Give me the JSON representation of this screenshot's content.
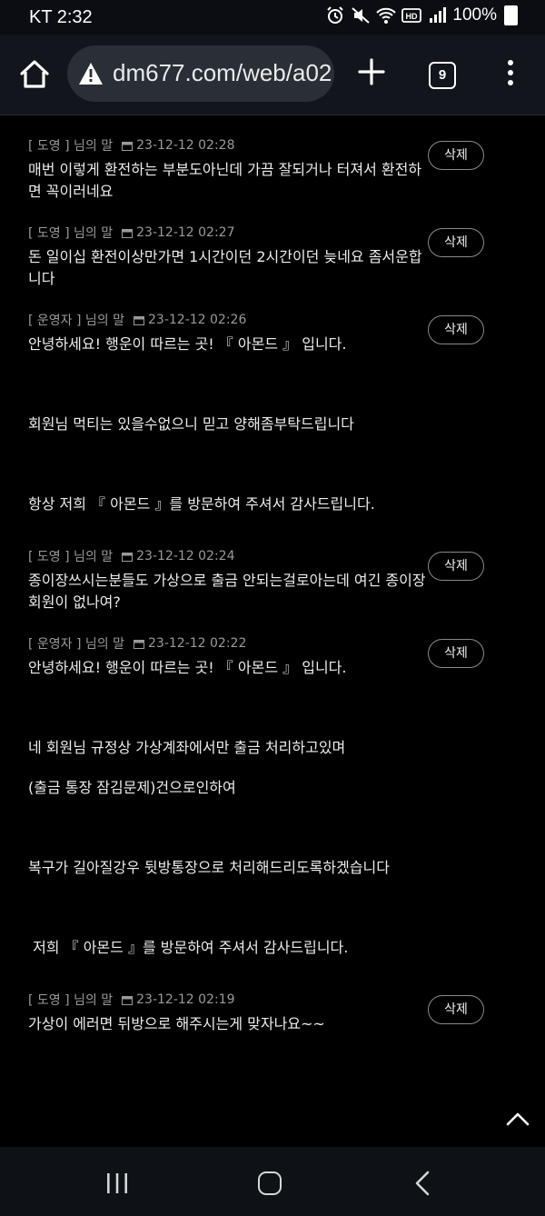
{
  "status_bar": {
    "carrier_time": "KT 2:32",
    "battery": "100%"
  },
  "browser": {
    "url": "dm677.com/web/a02",
    "tab_count": "9"
  },
  "comments": [
    {
      "role": "[ 도영 ]",
      "suffix": "님의 말",
      "date": "23-12-12 02:28",
      "lines": [
        "매번 이렇게 환전하는 부분도아닌데 가끔 잘되거나 터져서 환전하면 꼭이러네요"
      ],
      "delete_label": "삭제"
    },
    {
      "role": "[ 도영 ]",
      "suffix": "님의 말",
      "date": "23-12-12 02:27",
      "lines": [
        "돈 일이십 환전이상만가면 1시간이던 2시간이던 늦네요 좀서운합니다"
      ],
      "delete_label": "삭제"
    },
    {
      "role": "[ 운영자 ]",
      "suffix": "님의 말",
      "date": "23-12-12 02:26",
      "lines": [
        "안녕하세요! 행운이 따르는 곳! 『 아몬드 』 입니다.",
        "회원님 먹티는 있을수없으니 믿고 양해좀부탁드립니다",
        "항상 저희 『 아몬드 』를 방문하여 주셔서 감사드립니다."
      ],
      "delete_label": "삭제"
    },
    {
      "role": "[ 도영 ]",
      "suffix": "님의 말",
      "date": "23-12-12 02:24",
      "lines": [
        "종이장쓰시는분들도 가상으로 출금 안되는걸로아는데 여긴 종이장 회원이 없나여?"
      ],
      "delete_label": "삭제"
    },
    {
      "role": "[ 운영자 ]",
      "suffix": "님의 말",
      "date": "23-12-12 02:22",
      "lines": [
        "안녕하세요! 행운이 따르는 곳! 『 아몬드 』 입니다.",
        "네 회원님 규정상 가상계좌에서만 출금 처리하고있며",
        "(출금 통장 잠김문제)건으로인하여",
        "복구가 길아질강우 뒷방통장으로 처리해드리도록하겠습니다",
        " 저희 『 아몬드 』를 방문하여 주셔서 감사드립니다."
      ],
      "delete_label": "삭제"
    },
    {
      "role": "[ 도영 ]",
      "suffix": "님의 말",
      "date": "23-12-12 02:19",
      "lines": [
        "가상이 에러면 뒤방으로 해주시는게 맞자나요~~"
      ],
      "delete_label": "삭제"
    }
  ]
}
